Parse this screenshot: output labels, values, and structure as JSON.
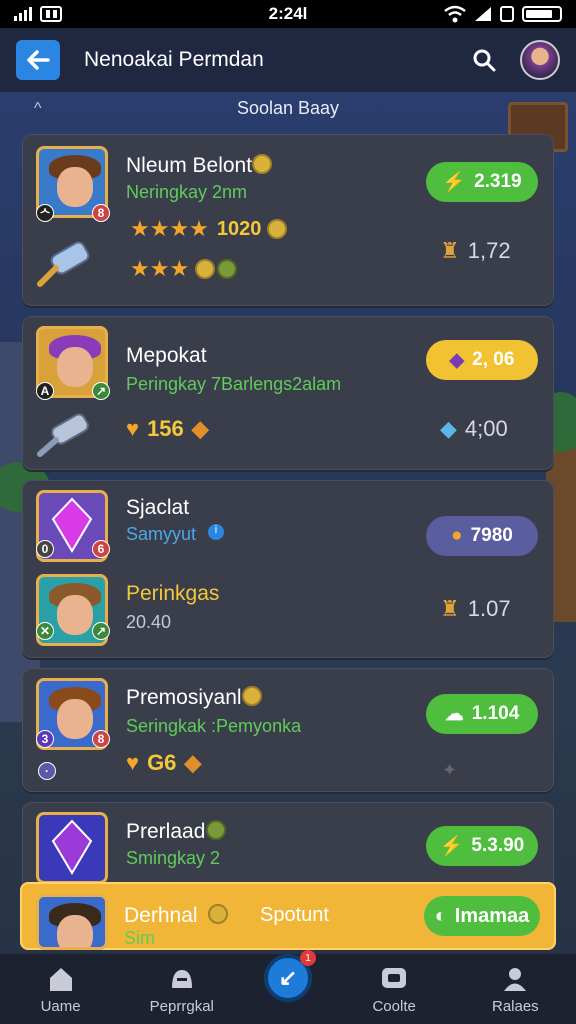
{
  "status_bar": {
    "time": "2:24l"
  },
  "app_bar": {
    "title": "Nenoakai Permdan"
  },
  "section": {
    "label": "Soolan Baay"
  },
  "cards": [
    {
      "title": "Nleum Belont",
      "subtitle": "Neringkay 2nm",
      "pill": "2.319",
      "rating_text": "1020",
      "stat": "1,72"
    },
    {
      "title": "Mepokat",
      "subtitle": "Peringkay 7Barlengs2alam",
      "pill": "2, 06",
      "count": "156",
      "stat": "4;00"
    },
    {
      "title": "Sjaclat",
      "subtitle": "Samyyut",
      "pill": "7980",
      "title2": "Perinkgas",
      "subtitle2": "20.40",
      "stat": "1.07"
    },
    {
      "title": "Premosiyanl",
      "subtitle": "Seringkak :Pemyonka",
      "pill": "1.104",
      "count": "G6"
    },
    {
      "title": "Prerlaad",
      "subtitle": "Smingkay 2",
      "pill": "5.3.90"
    }
  ],
  "highlight": {
    "title": "Derhnal",
    "subtitle": "Sim",
    "middle": "Spotunt",
    "button": "Imamaa"
  },
  "bottom_nav": [
    {
      "label": "Uame"
    },
    {
      "label": "Peprrgkal"
    },
    {
      "label": "Coolte"
    },
    {
      "label": "Ralaes"
    }
  ],
  "fab_badge": "1",
  "colors": {
    "accent_blue": "#2a86e0",
    "pill_green": "#4fbe3e",
    "pill_yellow": "#f1c232",
    "pill_purple": "#5a5d9e",
    "highlight_orange": "#f1b637"
  }
}
